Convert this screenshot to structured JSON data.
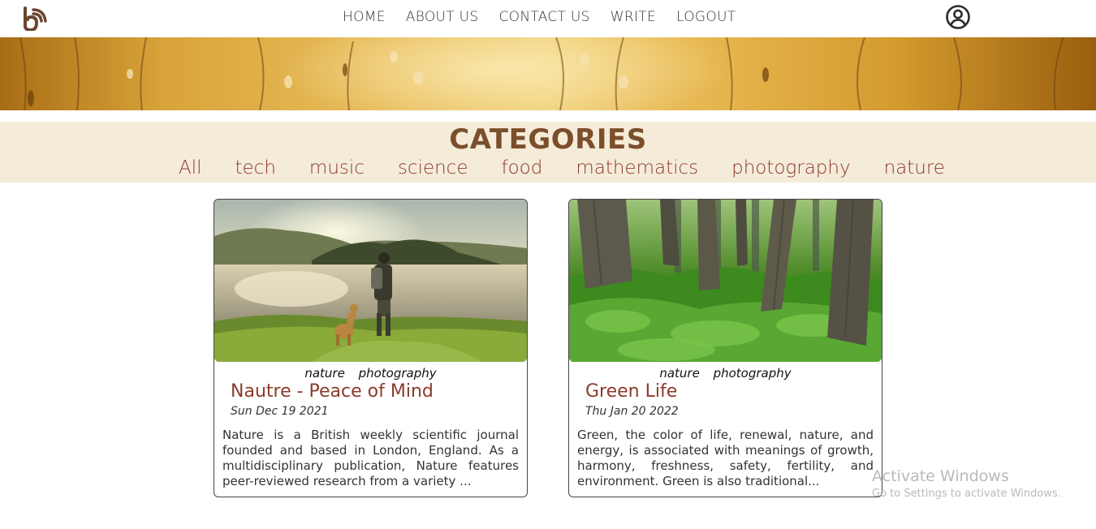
{
  "nav": {
    "logo_icon": "rss-b-logo-icon",
    "items": [
      "HOME",
      "ABOUT US",
      "CONTACT US",
      "WRITE",
      "LOGOUT"
    ],
    "user_icon": "user-circle-icon"
  },
  "categories": {
    "title": "CATEGORIES",
    "items": [
      "All",
      "tech",
      "music",
      "science",
      "food",
      "mathematics",
      "photography",
      "nature"
    ]
  },
  "posts": [
    {
      "tags": [
        "nature",
        "photography"
      ],
      "title": "Nautre - Peace of Mind",
      "date": "Sun Dec 19 2021",
      "excerpt": "Nature is a British weekly scientific journal founded and based in London, England. As a multidisciplinary publication, Nature features peer-reviewed research from a variety ..."
    },
    {
      "tags": [
        "nature",
        "photography"
      ],
      "title": "Green Life",
      "date": "Thu Jan 20 2022",
      "excerpt": "Green, the color of life, renewal, nature, and energy, is associated with meanings of growth, harmony, freshness, safety, fertility, and environment. Green is also traditional..."
    }
  ],
  "watermark": {
    "title": "Activate Windows",
    "subtitle": "Go to Settings to activate Windows."
  },
  "colors": {
    "accent_brown": "#7b4f2c",
    "category_red": "#8b3a2a",
    "category_bg": "#f5ebd9"
  }
}
